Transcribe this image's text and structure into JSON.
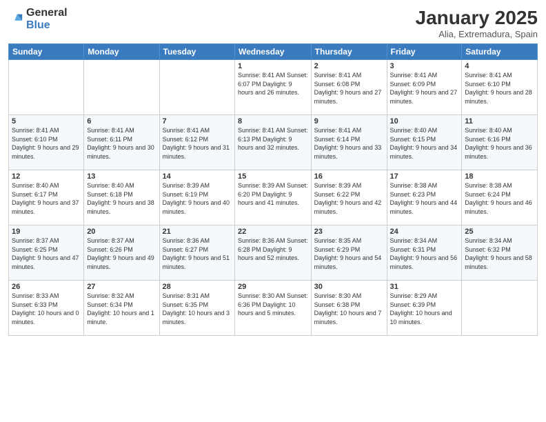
{
  "logo": {
    "general": "General",
    "blue": "Blue"
  },
  "title": "January 2025",
  "location": "Alia, Extremadura, Spain",
  "days_of_week": [
    "Sunday",
    "Monday",
    "Tuesday",
    "Wednesday",
    "Thursday",
    "Friday",
    "Saturday"
  ],
  "weeks": [
    [
      {
        "day": "",
        "info": ""
      },
      {
        "day": "",
        "info": ""
      },
      {
        "day": "",
        "info": ""
      },
      {
        "day": "1",
        "info": "Sunrise: 8:41 AM\nSunset: 6:07 PM\nDaylight: 9 hours and 26 minutes."
      },
      {
        "day": "2",
        "info": "Sunrise: 8:41 AM\nSunset: 6:08 PM\nDaylight: 9 hours and 27 minutes."
      },
      {
        "day": "3",
        "info": "Sunrise: 8:41 AM\nSunset: 6:09 PM\nDaylight: 9 hours and 27 minutes."
      },
      {
        "day": "4",
        "info": "Sunrise: 8:41 AM\nSunset: 6:10 PM\nDaylight: 9 hours and 28 minutes."
      }
    ],
    [
      {
        "day": "5",
        "info": "Sunrise: 8:41 AM\nSunset: 6:10 PM\nDaylight: 9 hours and 29 minutes."
      },
      {
        "day": "6",
        "info": "Sunrise: 8:41 AM\nSunset: 6:11 PM\nDaylight: 9 hours and 30 minutes."
      },
      {
        "day": "7",
        "info": "Sunrise: 8:41 AM\nSunset: 6:12 PM\nDaylight: 9 hours and 31 minutes."
      },
      {
        "day": "8",
        "info": "Sunrise: 8:41 AM\nSunset: 6:13 PM\nDaylight: 9 hours and 32 minutes."
      },
      {
        "day": "9",
        "info": "Sunrise: 8:41 AM\nSunset: 6:14 PM\nDaylight: 9 hours and 33 minutes."
      },
      {
        "day": "10",
        "info": "Sunrise: 8:40 AM\nSunset: 6:15 PM\nDaylight: 9 hours and 34 minutes."
      },
      {
        "day": "11",
        "info": "Sunrise: 8:40 AM\nSunset: 6:16 PM\nDaylight: 9 hours and 36 minutes."
      }
    ],
    [
      {
        "day": "12",
        "info": "Sunrise: 8:40 AM\nSunset: 6:17 PM\nDaylight: 9 hours and 37 minutes."
      },
      {
        "day": "13",
        "info": "Sunrise: 8:40 AM\nSunset: 6:18 PM\nDaylight: 9 hours and 38 minutes."
      },
      {
        "day": "14",
        "info": "Sunrise: 8:39 AM\nSunset: 6:19 PM\nDaylight: 9 hours and 40 minutes."
      },
      {
        "day": "15",
        "info": "Sunrise: 8:39 AM\nSunset: 6:20 PM\nDaylight: 9 hours and 41 minutes."
      },
      {
        "day": "16",
        "info": "Sunrise: 8:39 AM\nSunset: 6:22 PM\nDaylight: 9 hours and 42 minutes."
      },
      {
        "day": "17",
        "info": "Sunrise: 8:38 AM\nSunset: 6:23 PM\nDaylight: 9 hours and 44 minutes."
      },
      {
        "day": "18",
        "info": "Sunrise: 8:38 AM\nSunset: 6:24 PM\nDaylight: 9 hours and 46 minutes."
      }
    ],
    [
      {
        "day": "19",
        "info": "Sunrise: 8:37 AM\nSunset: 6:25 PM\nDaylight: 9 hours and 47 minutes."
      },
      {
        "day": "20",
        "info": "Sunrise: 8:37 AM\nSunset: 6:26 PM\nDaylight: 9 hours and 49 minutes."
      },
      {
        "day": "21",
        "info": "Sunrise: 8:36 AM\nSunset: 6:27 PM\nDaylight: 9 hours and 51 minutes."
      },
      {
        "day": "22",
        "info": "Sunrise: 8:36 AM\nSunset: 6:28 PM\nDaylight: 9 hours and 52 minutes."
      },
      {
        "day": "23",
        "info": "Sunrise: 8:35 AM\nSunset: 6:29 PM\nDaylight: 9 hours and 54 minutes."
      },
      {
        "day": "24",
        "info": "Sunrise: 8:34 AM\nSunset: 6:31 PM\nDaylight: 9 hours and 56 minutes."
      },
      {
        "day": "25",
        "info": "Sunrise: 8:34 AM\nSunset: 6:32 PM\nDaylight: 9 hours and 58 minutes."
      }
    ],
    [
      {
        "day": "26",
        "info": "Sunrise: 8:33 AM\nSunset: 6:33 PM\nDaylight: 10 hours and 0 minutes."
      },
      {
        "day": "27",
        "info": "Sunrise: 8:32 AM\nSunset: 6:34 PM\nDaylight: 10 hours and 1 minute."
      },
      {
        "day": "28",
        "info": "Sunrise: 8:31 AM\nSunset: 6:35 PM\nDaylight: 10 hours and 3 minutes."
      },
      {
        "day": "29",
        "info": "Sunrise: 8:30 AM\nSunset: 6:36 PM\nDaylight: 10 hours and 5 minutes."
      },
      {
        "day": "30",
        "info": "Sunrise: 8:30 AM\nSunset: 6:38 PM\nDaylight: 10 hours and 7 minutes."
      },
      {
        "day": "31",
        "info": "Sunrise: 8:29 AM\nSunset: 6:39 PM\nDaylight: 10 hours and 10 minutes."
      },
      {
        "day": "",
        "info": ""
      }
    ]
  ]
}
